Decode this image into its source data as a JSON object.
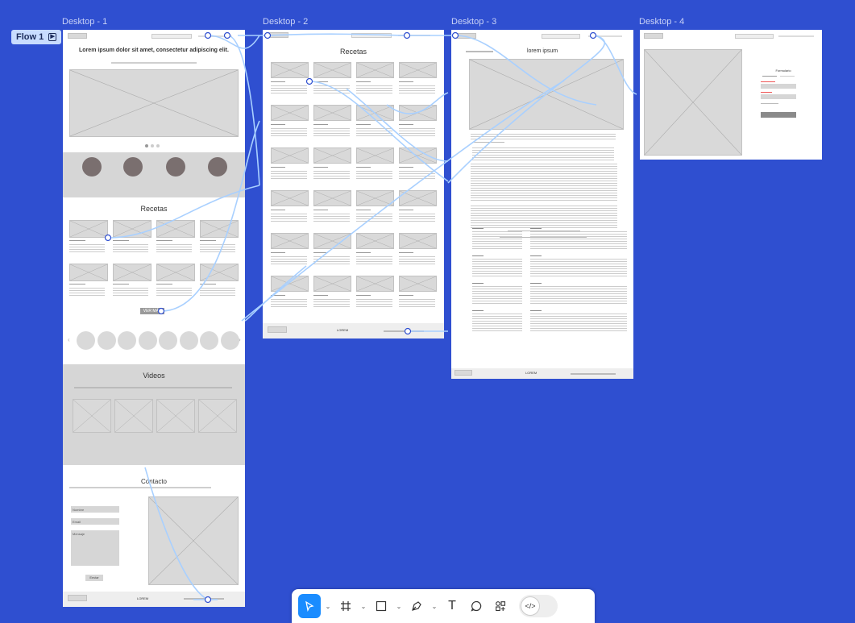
{
  "frames": {
    "d1": {
      "label": "Desktop - 1"
    },
    "d2": {
      "label": "Desktop - 2"
    },
    "d3": {
      "label": "Desktop - 3"
    },
    "d4": {
      "label": "Desktop - 4"
    }
  },
  "flow": {
    "label": "Flow 1"
  },
  "d1": {
    "hero_title": "Lorem ipsum dolor sit amet, consectetur adipiscing elit.",
    "recetas_title": "Recetas",
    "ver_mas": "VER MÁS",
    "videos_title": "Videos",
    "contacto_title": "Contacto",
    "form_fields": [
      "Nombre",
      "Email",
      "Mensaje"
    ],
    "submit": "Enviar",
    "footer_logo": "LOREM"
  },
  "d2": {
    "title": "Recetas",
    "footer_logo": "LOREM"
  },
  "d3": {
    "title": "lorem ipsum",
    "footer_logo": "LOREM"
  },
  "d4": {
    "form_title": "Formulario"
  },
  "toolbar": {
    "code_label": "</>"
  },
  "colors": {
    "canvas": "#2f4fd0",
    "connector": "#a9d0ff",
    "accent": "#1a8cff"
  },
  "icons": [
    "move-icon",
    "frame-icon",
    "rectangle-icon",
    "pen-icon",
    "text-icon",
    "comment-icon",
    "actions-icon",
    "dev-mode-icon"
  ]
}
